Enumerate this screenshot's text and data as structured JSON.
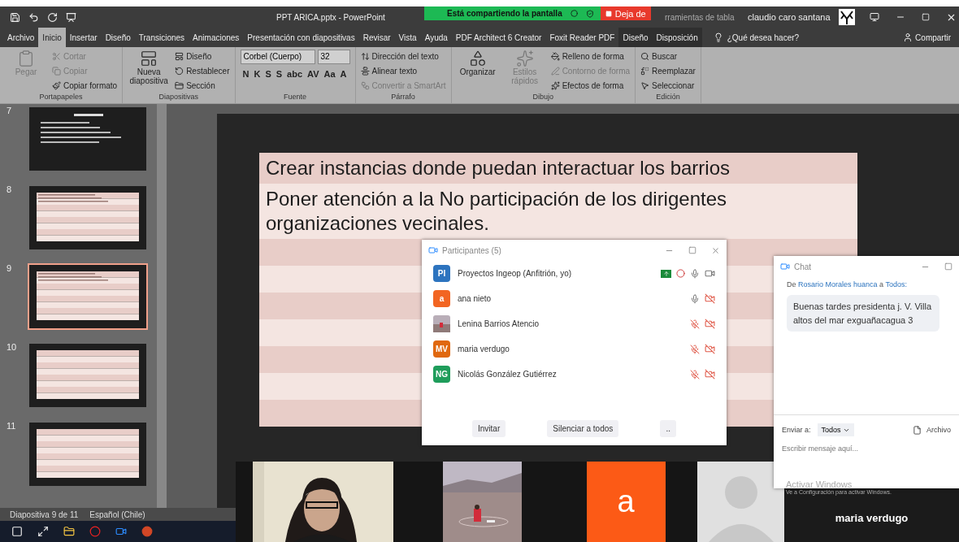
{
  "titlebar": {
    "title": "PPT ARICA.pptx - PowerPoint",
    "context": "rramientas de tabla",
    "user": "claudio caro santana"
  },
  "sharing": {
    "status": "Está compartiendo la pantalla",
    "stop": "Deja de"
  },
  "menu_tabs": [
    {
      "label": "Archivo",
      "selected": false,
      "kind": "tab"
    },
    {
      "label": "Inicio",
      "selected": true,
      "kind": "tab"
    },
    {
      "label": "Insertar",
      "selected": false,
      "kind": "tab"
    },
    {
      "label": "Diseño",
      "selected": false,
      "kind": "tab"
    },
    {
      "label": "Transiciones",
      "selected": false,
      "kind": "tab"
    },
    {
      "label": "Animaciones",
      "selected": false,
      "kind": "tab"
    },
    {
      "label": "Presentación con diapositivas",
      "selected": false,
      "kind": "tab"
    },
    {
      "label": "Revisar",
      "selected": false,
      "kind": "tab"
    },
    {
      "label": "Vista",
      "selected": false,
      "kind": "tab"
    },
    {
      "label": "Ayuda",
      "selected": false,
      "kind": "tab"
    },
    {
      "label": "PDF Architect 6 Creator",
      "selected": false,
      "kind": "tab"
    },
    {
      "label": "Foxit Reader PDF",
      "selected": false,
      "kind": "tab"
    },
    {
      "label": "Diseño",
      "selected": false,
      "kind": "context"
    },
    {
      "label": "Disposición",
      "selected": false,
      "kind": "context"
    }
  ],
  "help": "¿Qué desea hacer?",
  "share": "Compartir",
  "ribbon_groups": [
    {
      "label": "Portapapeles",
      "commands": [
        {
          "label": "Pegar",
          "kind": "large",
          "disabled": true
        },
        {
          "label": "Cortar",
          "kind": "small",
          "disabled": true
        },
        {
          "label": "Copiar",
          "kind": "small",
          "disabled": true
        },
        {
          "label": "Copiar formato",
          "kind": "small",
          "disabled": false
        }
      ]
    },
    {
      "label": "Diapositivas",
      "commands": [
        {
          "label": "Nueva diapositiva",
          "kind": "large",
          "disabled": false
        },
        {
          "label": "Diseño",
          "kind": "small",
          "disabled": false
        },
        {
          "label": "Restablecer",
          "kind": "small",
          "disabled": false
        },
        {
          "label": "Sección",
          "kind": "small",
          "disabled": false
        }
      ]
    },
    {
      "label": "Fuente",
      "font": "Corbel (Cuerpo)",
      "size": "32",
      "format_buttons": [
        "N",
        "K",
        "S",
        "S",
        "abc",
        "AV",
        "Aa",
        "A"
      ]
    },
    {
      "label": "Párrafo",
      "commands": [
        {
          "label": "Dirección del texto",
          "kind": "small",
          "disabled": false
        },
        {
          "label": "Alinear texto",
          "kind": "small",
          "disabled": false
        },
        {
          "label": "Convertir a SmartArt",
          "kind": "small",
          "disabled": true
        }
      ]
    },
    {
      "label": "Dibujo",
      "commands": [
        {
          "label": "Organizar",
          "kind": "large",
          "disabled": false
        },
        {
          "label": "Estilos rápidos",
          "kind": "large",
          "disabled": true
        },
        {
          "label": "Relleno de forma",
          "kind": "small",
          "disabled": false
        },
        {
          "label": "Contorno de forma",
          "kind": "small",
          "disabled": true
        },
        {
          "label": "Efectos de forma",
          "kind": "small",
          "disabled": false
        }
      ]
    },
    {
      "label": "Edición",
      "commands": [
        {
          "label": "Buscar",
          "kind": "small",
          "disabled": false
        },
        {
          "label": "Reemplazar",
          "kind": "small",
          "disabled": false
        },
        {
          "label": "Seleccionar",
          "kind": "small",
          "disabled": false
        }
      ]
    }
  ],
  "slides": [
    {
      "number": "7",
      "kind": "dark",
      "selected": false
    },
    {
      "number": "8",
      "kind": "table",
      "selected": false
    },
    {
      "number": "9",
      "kind": "table",
      "selected": true
    },
    {
      "number": "10",
      "kind": "empty",
      "selected": false
    },
    {
      "number": "11",
      "kind": "empty",
      "selected": false
    }
  ],
  "slide_rows": [
    "Crear instancias donde puedan interactuar los barrios",
    "Poner atención a la No participación de los dirigentes organizaciones vecinales."
  ],
  "status_bar": {
    "slide": "Diapositiva 9 de 11",
    "language": "Español (Chile)"
  },
  "participants": {
    "title": "Participantes (5)",
    "people": [
      {
        "initials": "PI",
        "name": "Proyectos Ingeop (Anfitrión, yo)",
        "kind": "initials",
        "color": "#2d74bf",
        "host": true,
        "muted": false,
        "mic_shown": true,
        "video_off": false
      },
      {
        "initials": "a",
        "name": "ana nieto",
        "kind": "initials",
        "color": "#f26522",
        "host": false,
        "muted": false,
        "mic_shown": true,
        "video_off": true
      },
      {
        "name": "Lenina Barrios Atencio",
        "host": false,
        "muted": true,
        "mic_shown": true,
        "video_off": true
      },
      {
        "initials": "MV",
        "name": "maria verdugo",
        "kind": "initials",
        "color": "#e0680f",
        "host": false,
        "muted": true,
        "mic_shown": true,
        "video_off": true
      },
      {
        "initials": "NG",
        "name": "Nicolás González Gutiérrez",
        "kind": "initials",
        "color": "#1f9d5b",
        "host": false,
        "muted": true,
        "mic_shown": true,
        "video_off": true
      }
    ],
    "buttons": [
      "Invitar",
      "Silenciar a todos",
      ".."
    ]
  },
  "chat": {
    "title": "Chat",
    "from_prefix": "De",
    "sender": "Rosario Morales huanca",
    "to_prefix": "a",
    "recipient": "Todos:",
    "message": "Buenas tardes presidenta j. V. Villa altos del mar exguañacagua 3",
    "send_to_label": "Enviar a:",
    "send_to": "Todos",
    "file": "Archivo",
    "placeholder": "Escribir mensaje aquí..."
  },
  "videos": [
    {
      "kind": "camera"
    },
    {
      "kind": "landscape"
    },
    {
      "kind": "initial",
      "letter": "a",
      "color": "#fc5a16"
    },
    {
      "kind": "avatar"
    },
    {
      "kind": "name",
      "name": "maria verdugo"
    }
  ],
  "activation": {
    "title": "Activar Windows",
    "subtitle": "Ve a Configuración para activar Windows."
  }
}
